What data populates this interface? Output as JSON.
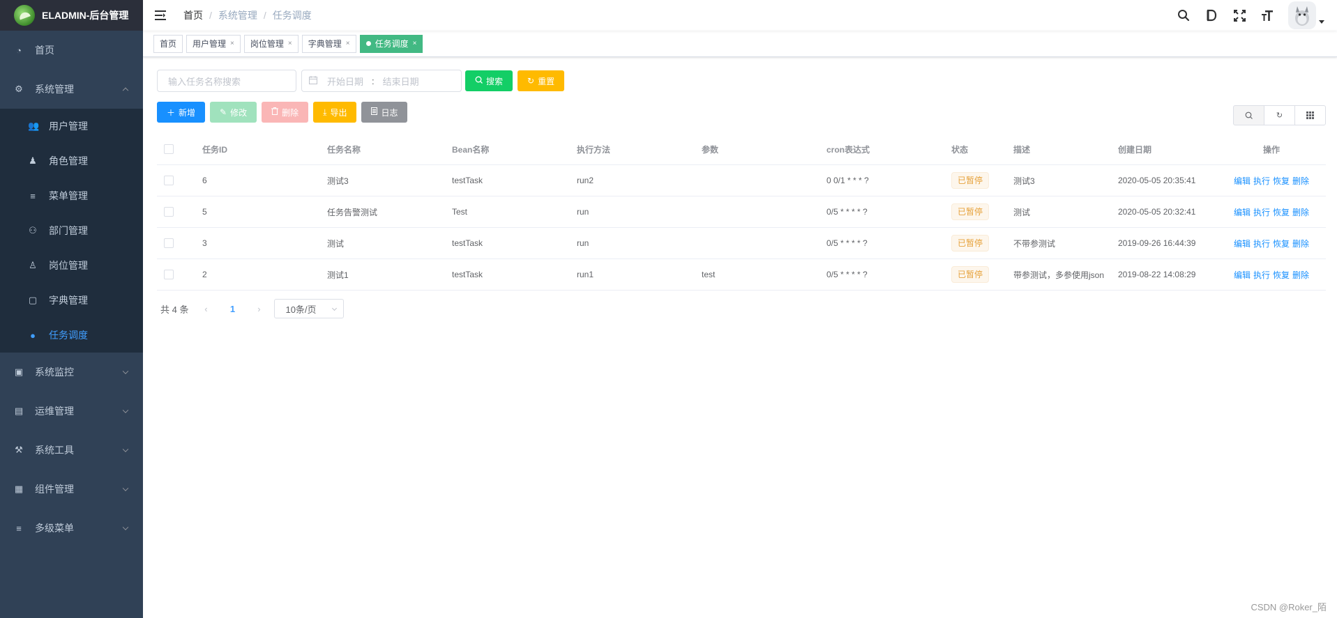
{
  "sidebar": {
    "title": "ELADMIN-后台管理",
    "items": [
      {
        "label": "首页",
        "icon": "dashboard-icon",
        "glyph": "◔"
      },
      {
        "label": "系统管理",
        "icon": "gear-icon",
        "glyph": "⚙",
        "expanded": true
      },
      {
        "label": "系统监控",
        "icon": "monitor-icon",
        "glyph": "▣"
      },
      {
        "label": "运维管理",
        "icon": "server-icon",
        "glyph": "▤"
      },
      {
        "label": "系统工具",
        "icon": "tools-icon",
        "glyph": "⚒"
      },
      {
        "label": "组件管理",
        "icon": "components-icon",
        "glyph": "▦"
      },
      {
        "label": "多级菜单",
        "icon": "menu-icon",
        "glyph": "≡"
      }
    ],
    "sub_items": [
      {
        "label": "用户管理",
        "icon": "user-icon",
        "glyph": "👥"
      },
      {
        "label": "角色管理",
        "icon": "role-icon",
        "glyph": "♟"
      },
      {
        "label": "菜单管理",
        "icon": "menu-list-icon",
        "glyph": "≡"
      },
      {
        "label": "部门管理",
        "icon": "dept-icon",
        "glyph": "⚇"
      },
      {
        "label": "岗位管理",
        "icon": "post-icon",
        "glyph": "♙"
      },
      {
        "label": "字典管理",
        "icon": "dictionary-icon",
        "glyph": "▢"
      },
      {
        "label": "任务调度",
        "icon": "timer-icon",
        "glyph": "●",
        "active": true
      }
    ]
  },
  "navbar": {
    "breadcrumb": [
      "首页",
      "系统管理",
      "任务调度"
    ],
    "icons": [
      "search-icon",
      "doc-icon",
      "fullscreen-icon",
      "font-size-icon"
    ]
  },
  "tags": [
    {
      "label": "首页",
      "closable": false
    },
    {
      "label": "用户管理",
      "closable": true
    },
    {
      "label": "岗位管理",
      "closable": true
    },
    {
      "label": "字典管理",
      "closable": true
    },
    {
      "label": "任务调度",
      "closable": true,
      "active": true
    }
  ],
  "filters": {
    "search_placeholder": "输入任务名称搜索",
    "start_placeholder": "开始日期",
    "range_separator": ":",
    "end_placeholder": "结束日期",
    "search_label": "搜索",
    "reset_label": "重置"
  },
  "crud": {
    "add": "新增",
    "edit": "修改",
    "delete": "删除",
    "export": "导出",
    "log": "日志"
  },
  "table": {
    "columns": [
      "任务ID",
      "任务名称",
      "Bean名称",
      "执行方法",
      "参数",
      "cron表达式",
      "状态",
      "描述",
      "创建日期",
      "操作"
    ],
    "rows": [
      {
        "id": "6",
        "name": "测试3",
        "bean": "testTask",
        "method": "run2",
        "params": "",
        "cron": "0 0/1 * * * ?",
        "status": "已暂停",
        "desc": "测试3",
        "created": "2020-05-05 20:35:41"
      },
      {
        "id": "5",
        "name": "任务告警测试",
        "bean": "Test",
        "method": "run",
        "params": "",
        "cron": "0/5 * * * * ?",
        "status": "已暂停",
        "desc": "测试",
        "created": "2020-05-05 20:32:41"
      },
      {
        "id": "3",
        "name": "测试",
        "bean": "testTask",
        "method": "run",
        "params": "",
        "cron": "0/5 * * * * ?",
        "status": "已暂停",
        "desc": "不带参测试",
        "created": "2019-09-26 16:44:39"
      },
      {
        "id": "2",
        "name": "测试1",
        "bean": "testTask",
        "method": "run1",
        "params": "test",
        "cron": "0/5 * * * * ?",
        "status": "已暂停",
        "desc": "带参测试，多参使用json",
        "created": "2019-08-22 14:08:29"
      }
    ],
    "actions": [
      "编辑",
      "执行",
      "恢复",
      "删除"
    ]
  },
  "pagination": {
    "total": "共 4 条",
    "current": "1",
    "page_size": "10条/页"
  },
  "watermark": "CSDN @Roker_陌",
  "colors": {
    "sidebar_bg": "#304156",
    "active_menu": "#409eff",
    "tag_active": "#42b983",
    "primary": "#1890ff",
    "success": "#13ce66",
    "warning": "#ffba00"
  }
}
